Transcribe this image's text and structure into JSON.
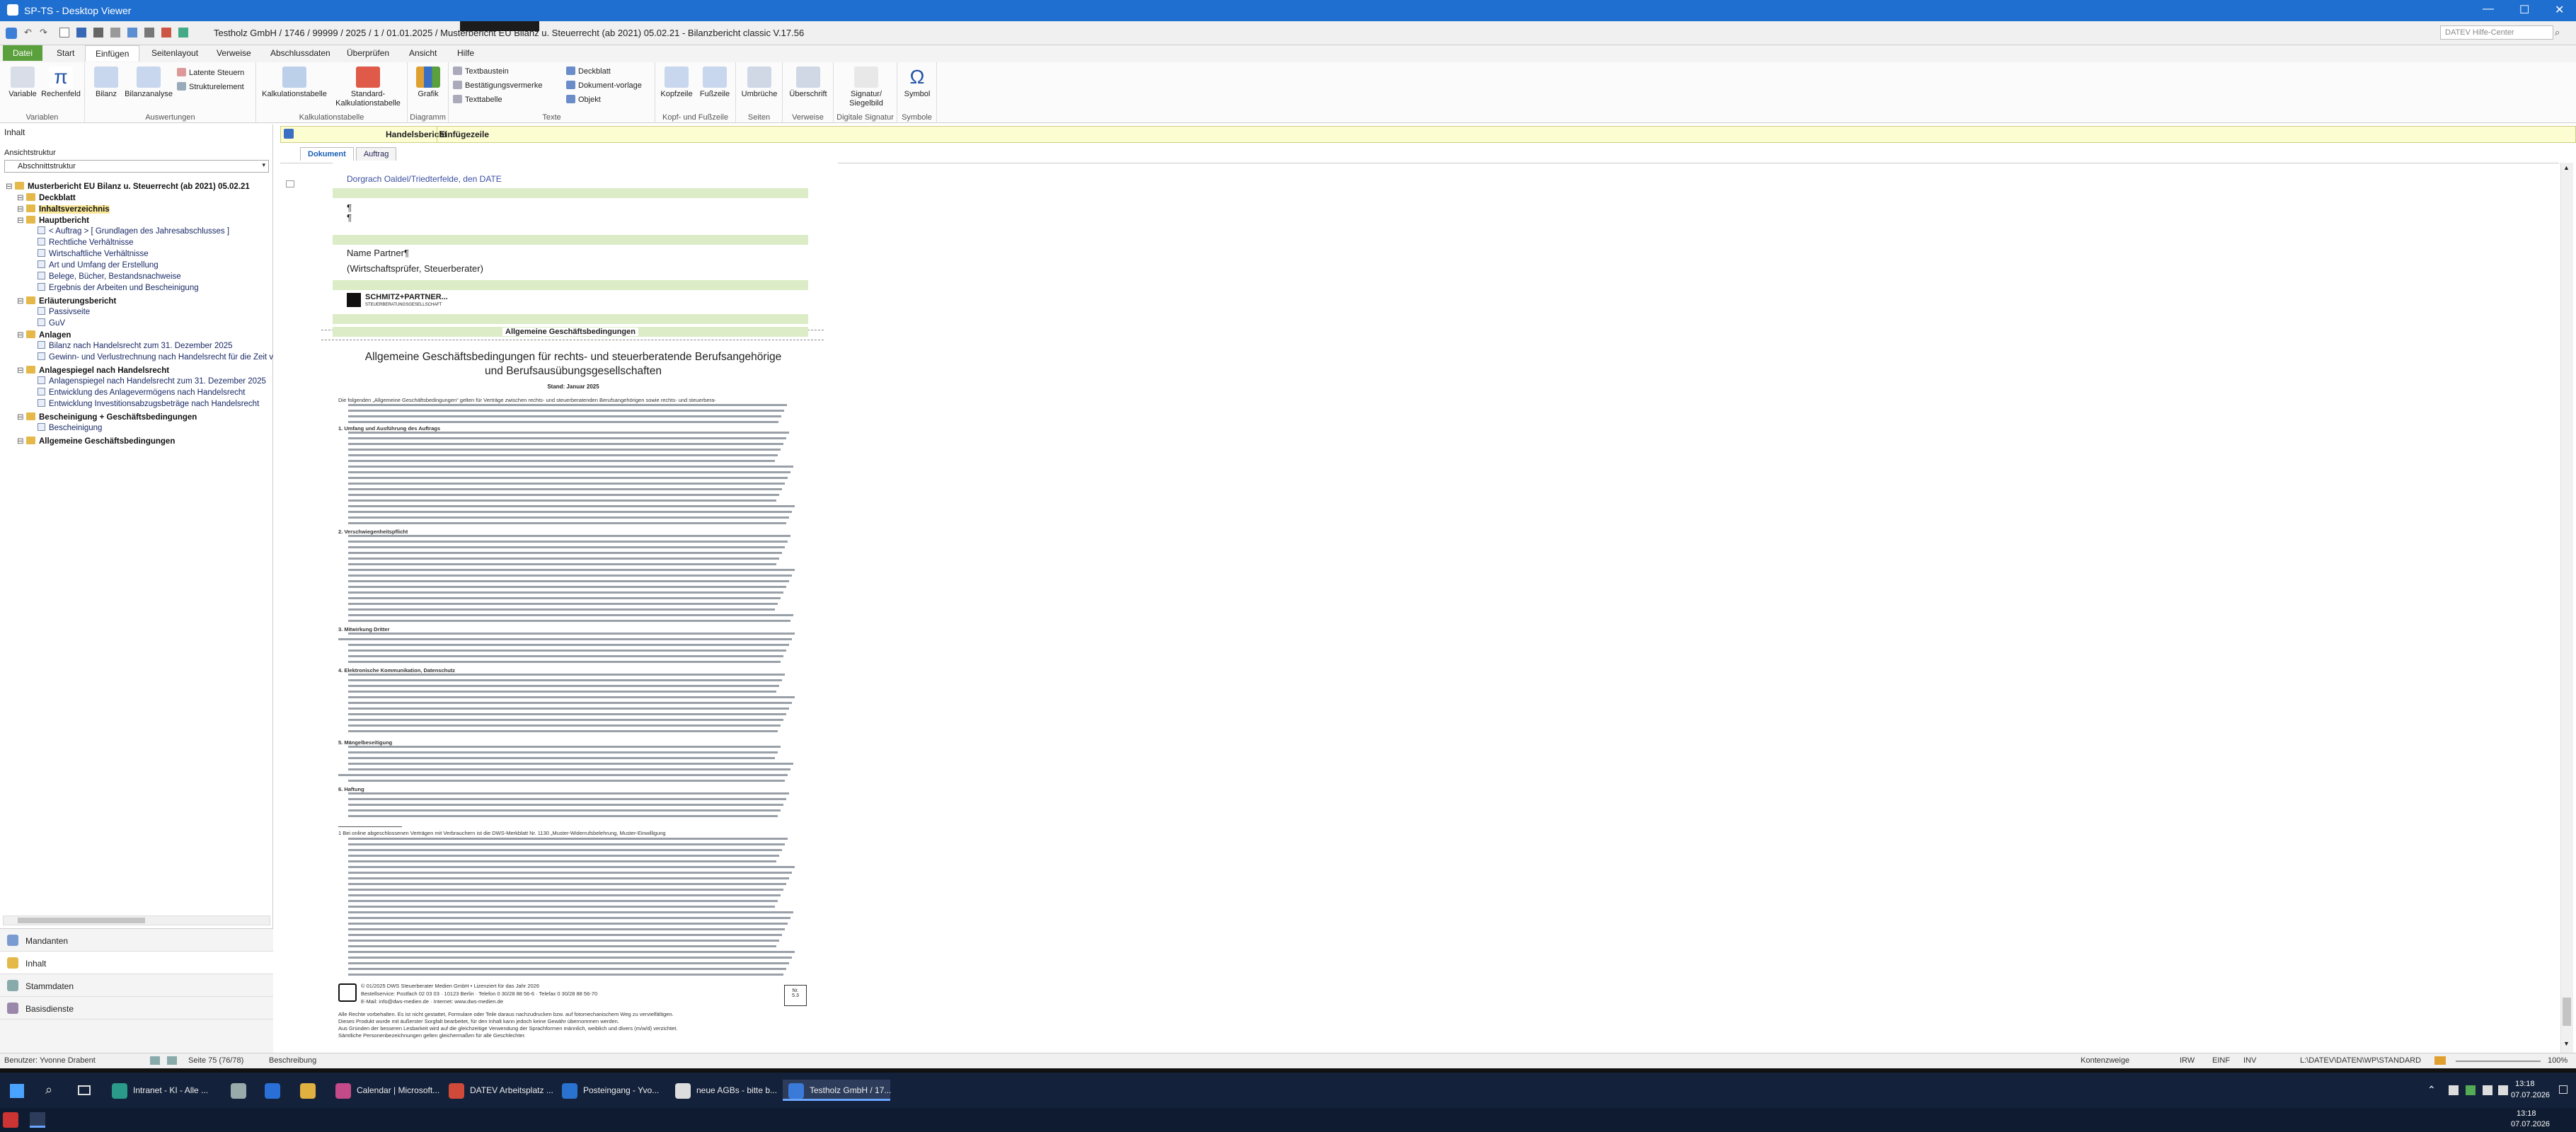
{
  "titlebar": {
    "title": "SP-TS - Desktop Viewer"
  },
  "appbar": {
    "doc_title": "Testholz GmbH / 1746 / 99999 / 2025 / 1 / 01.01.2025 / Musterbericht EU Bilanz u. Steuerrecht (ab 2021) 05.02.21 - Bilanzbericht classic V.17.56",
    "help_placeholder": "DATEV Hilfe-Center"
  },
  "menu": {
    "tabs": [
      "Datei",
      "Start",
      "Einfügen",
      "Seitenlayout",
      "Verweise",
      "Abschlussdaten",
      "Überprüfen",
      "Ansicht",
      "Hilfe"
    ],
    "active": "Einfügen"
  },
  "ribbon": {
    "groups": [
      "Variablen",
      "Auswertungen",
      "Kalkulationstabelle",
      "Diagramm",
      "Texte",
      "Kopf- und Fußzeile",
      "Seiten",
      "Verweise",
      "Digitale Signatur",
      "Symbole"
    ],
    "variable": "Variable",
    "rechenfeld": "Rechenfeld",
    "bilanz": "Bilanz",
    "bilanzanalyse": "Bilanzanalyse",
    "latente": "Latente Steuern",
    "struktur": "Strukturelement",
    "kalk": "Kalkulationstabelle",
    "standard": "Standard-Kalkulationstabelle",
    "grafik": "Grafik",
    "textbaustein": "Textbaustein",
    "bestaetigung": "Bestätigungsvermerke",
    "texttabelle": "Texttabelle",
    "deckblatt": "Deckblatt",
    "dokumentvorlage": "Dokument-vorlage",
    "objekt": "Objekt",
    "kopfzeile": "Kopfzeile",
    "fusszeile": "Fußzeile",
    "umbrueche": "Umbrüche",
    "ueberschrift": "Überschrift",
    "signatur": "Signatur/ Siegelbild",
    "symbol": "Symbol"
  },
  "sidebar": {
    "inhalt": "Inhalt",
    "ansicht_label": "Ansichtstruktur",
    "ansicht_value": "Abschnittstruktur",
    "tree": [
      {
        "t": "Musterbericht EU Bilanz u. Steuerrecht (ab 2021) 05.02.21",
        "b": true,
        "l": 0
      },
      {
        "t": "Deckblatt",
        "b": true,
        "l": 1
      },
      {
        "t": "Inhaltsverzeichnis",
        "b": true,
        "l": 1,
        "sel": true
      },
      {
        "t": "Hauptbericht",
        "b": true,
        "l": 1
      },
      {
        "t": "< Auftrag > [ Grundlagen des Jahresabschlusses ]",
        "l": 2
      },
      {
        "t": "Rechtliche Verhältnisse",
        "l": 2
      },
      {
        "t": "Wirtschaftliche Verhältnisse",
        "l": 2
      },
      {
        "t": "Art und Umfang der Erstellung",
        "l": 2
      },
      {
        "t": "Belege, Bücher, Bestandsnachweise",
        "l": 2
      },
      {
        "t": "Ergebnis der Arbeiten und Bescheinigung",
        "l": 2
      },
      {
        "t": "Erläuterungsbericht",
        "b": true,
        "l": 1
      },
      {
        "t": "Passivseite",
        "l": 2
      },
      {
        "t": "GuV",
        "l": 2
      },
      {
        "t": "Anlagen",
        "b": true,
        "l": 1
      },
      {
        "t": "Bilanz nach Handelsrecht zum 31. Dezember 2025",
        "l": 2
      },
      {
        "t": "Gewinn- und Verlustrechnung nach Handelsrecht für die Zeit v",
        "l": 2
      },
      {
        "t": "Anlagespiegel nach Handelsrecht",
        "b": true,
        "l": 1
      },
      {
        "t": "Anlagenspiegel nach Handelsrecht zum 31. Dezember 2025",
        "l": 2
      },
      {
        "t": "Entwicklung des Anlagevermögens nach Handelsrecht",
        "l": 2
      },
      {
        "t": "Entwicklung Investitionsabzugsbeträge nach Handelsrecht",
        "l": 2
      },
      {
        "t": "Bescheinigung + Geschäftsbedingungen",
        "b": true,
        "l": 1
      },
      {
        "t": "Bescheinigung",
        "l": 2
      },
      {
        "t": "Allgemeine Geschäftsbedingungen",
        "b": true,
        "l": 1
      }
    ],
    "panes": [
      "Mandanten",
      "Inhalt",
      "Stammdaten",
      "Basisdienste"
    ]
  },
  "docheader": {
    "col1": "Handelsbericht",
    "col2": "Einfügezeile"
  },
  "doctabs": [
    "Dokument",
    "Auftrag"
  ],
  "page": {
    "sig_line": "Dorgrach Oaldel/Triedterfelde, den DATE",
    "para1": "¶",
    "para2": "¶",
    "name": "Name Partner¶",
    "role": "(Wirtschaftsprüfer, Steuerberater)",
    "firm": "SCHMITZ+PARTNER...",
    "firm_sub": "STEUERBERATUNGSGESELLSCHAFT",
    "section_band": "Allgemeine Geschäftsbedingungen",
    "agb_title_1": "Allgemeine Geschäftsbedingungen für rechts- und steuerberatende Berufsangehörige",
    "agb_title_2": "und Berufsausübungsgesellschaften",
    "stand": "Stand: Januar 2025",
    "intro": "Die folgenden „Allgemeine Geschäftsbedingungen“ gelten für Verträge zwischen rechts- und steuerberatenden Berufsangehörigen sowie rechts- und steuerbera-",
    "s1": "1.   Umfang und Ausführung des Auftrags",
    "s2": "2.   Verschwiegenheitspflicht",
    "s3": "3.   Mitwirkung Dritter",
    "s4": "4.   Elektronische Kommunikation, Datenschutz",
    "s5": "5.   Mängelbeseitigung",
    "s6": "6.   Haftung",
    "fn1": "1   Bei online abgeschlossenen Verträgen mit Verbrauchern ist die DWS-Merkblatt Nr. 1130 „Muster-Widerrufsbelehrung, Muster-Einwilligung",
    "copyright": "© 01/2025 DWS Steuerberater Medien GmbH • Lizenziert für das Jahr 2026",
    "addr": "Bestellservice: Postfach 02 03 03 · 10123 Berlin · Telefon 0 30/28 88 56-6 · Telefax 0 30/28 88 56-70",
    "web": "E-Mail: info@dws-medien.de · Internet: www.dws-medien.de",
    "rights1": "Alle Rechte vorbehalten. Es ist nicht gestattet, Formulare oder Teile daraus nachzudrucken bzw. auf fotomechanischem Weg zu vervielfältigen.",
    "rights2": "Dieses Produkt wurde mit äußerster Sorgfalt bearbeitet, für den Inhalt kann jedoch keine Gewähr übernommen werden.",
    "rights3": "Aus Gründen der besseren Lesbarkeit wird auf die gleichzeitige Verwendung der Sprachformen männlich, weiblich und divers (m/w/d) verzichtet.",
    "rights4": "Sämtliche Personenbezeichnungen gelten gleichermaßen für alle Geschlechter.",
    "nr_label": "Nr.",
    "nr_value": "5.3"
  },
  "status": {
    "user": "Benutzer: Yvonne Drabent",
    "page": "Seite 75 (76/78)",
    "mode": "Beschreibung",
    "kontenzweig": "Kontenzweige",
    "irw": "IRW",
    "einf": "EINF",
    "inv": "INV",
    "path": "L:\\DATEV\\DATEN\\WP\\STANDARD",
    "zoom": "100%"
  },
  "taskbar": {
    "items": [
      "Intranet - KI - Alle ...",
      "",
      "",
      "Calendar | Microsoft...",
      "DATEV Arbeitsplatz ...",
      "Posteingang - Yvo...",
      "neue AGBs - bitte b...",
      "Testholz GmbH / 17..."
    ],
    "time": "13:18",
    "date": "07.07.2026"
  }
}
